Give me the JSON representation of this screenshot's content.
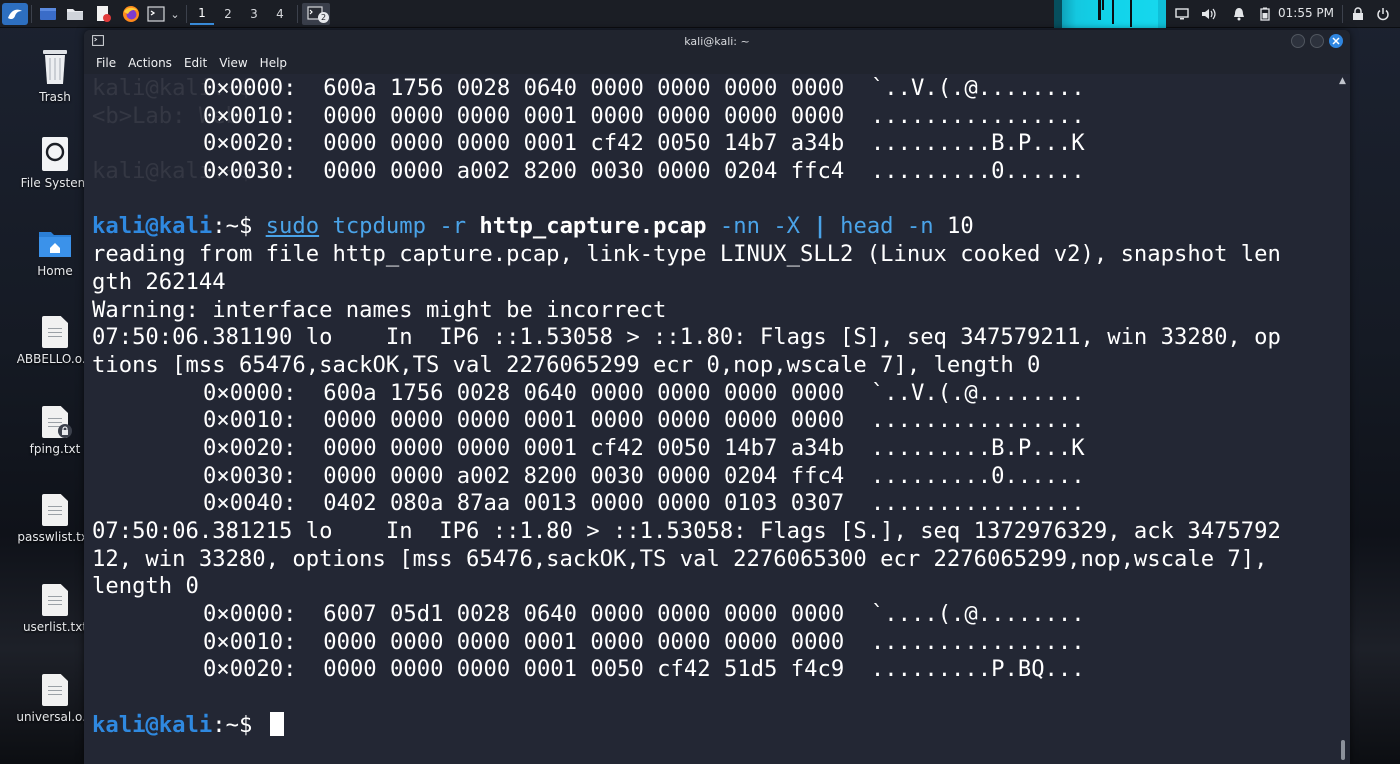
{
  "panel": {
    "workspaces": [
      "1",
      "2",
      "3",
      "4"
    ],
    "active_workspace": "1",
    "clock": "01:55 PM",
    "taskbar_badge": "2"
  },
  "desktop": {
    "icons": [
      {
        "label": "Trash",
        "icon": "trash-icon"
      },
      {
        "label": "File System",
        "icon": "drive-icon"
      },
      {
        "label": "Home",
        "icon": "home-folder-icon"
      },
      {
        "label": "ABBELLO.o...",
        "icon": "text-file-icon"
      },
      {
        "label": "fping.txt",
        "icon": "locked-text-file-icon"
      },
      {
        "label": "passwlist.txt",
        "icon": "text-file-icon"
      },
      {
        "label": "userlist.txt",
        "icon": "text-file-icon"
      },
      {
        "label": "universal.o...",
        "icon": "text-file-icon"
      }
    ]
  },
  "window": {
    "title": "kali@kali: ~",
    "menu": [
      "File",
      "Actions",
      "Edit",
      "View",
      "Help"
    ]
  },
  "terminal": {
    "ghost_lines": [
      "kali@kali:~$ ",
      "<b>Lab: Web",
      "",
      "kali@kali:~$ "
    ],
    "top_hex": [
      "0×0000:  600a 1756 0028 0640 0000 0000 0000 0000  `..V.(.@........",
      "0×0010:  0000 0000 0000 0001 0000 0000 0000 0000  ................",
      "0×0020:  0000 0000 0000 0001 cf42 0050 14b7 a34b  .........B.P...K",
      "0×0030:  0000 0000 a002 8200 0030 0000 0204 ffc4  .........0......"
    ],
    "prompt": {
      "user_host": "kali@kali",
      "path": ":~$ "
    },
    "command": {
      "sudo": "sudo",
      "tcpdump": "tcpdump",
      "flag_r": "-r",
      "file": "http_capture.pcap",
      "flag_nn": "-nn",
      "flag_X": "-X",
      "pipe": "|",
      "head": "head",
      "flag_n": "-n",
      "count": "10"
    },
    "output_a": [
      "reading from file http_capture.pcap, link-type LINUX_SLL2 (Linux cooked v2), snapshot len",
      "gth 262144",
      "Warning: interface names might be incorrect",
      "07:50:06.381190 lo    In  IP6 ::1.53058 > ::1.80: Flags [S], seq 347579211, win 33280, op",
      "tions [mss 65476,sackOK,TS val 2276065299 ecr 0,nop,wscale 7], length 0"
    ],
    "hex_a": [
      "0×0000:  600a 1756 0028 0640 0000 0000 0000 0000  `..V.(.@........",
      "0×0010:  0000 0000 0000 0001 0000 0000 0000 0000  ................",
      "0×0020:  0000 0000 0000 0001 cf42 0050 14b7 a34b  .........B.P...K",
      "0×0030:  0000 0000 a002 8200 0030 0000 0204 ffc4  .........0......",
      "0×0040:  0402 080a 87aa 0013 0000 0000 0103 0307  ................"
    ],
    "output_b": [
      "07:50:06.381215 lo    In  IP6 ::1.80 > ::1.53058: Flags [S.], seq 1372976329, ack 3475792",
      "12, win 33280, options [mss 65476,sackOK,TS val 2276065300 ecr 2276065299,nop,wscale 7],",
      "length 0"
    ],
    "hex_b": [
      "0×0000:  6007 05d1 0028 0640 0000 0000 0000 0000  `....(.@........",
      "0×0010:  0000 0000 0000 0001 0000 0000 0000 0000  ................",
      "0×0020:  0000 0000 0000 0001 0050 cf42 51d5 f4c9  .........P.BQ..."
    ]
  },
  "colors": {
    "prompt": "#2f89e0",
    "command": "#4aa3e8",
    "terminal_bg": "#232734",
    "panel_bg": "#1b1e25",
    "cpu_graph": "#11d3ea"
  }
}
